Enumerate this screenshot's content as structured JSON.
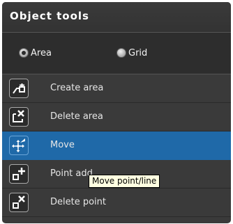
{
  "header": {
    "title": "Object tools"
  },
  "mode": {
    "options": [
      {
        "label": "Area",
        "checked": true
      },
      {
        "label": "Grid",
        "checked": false
      }
    ]
  },
  "tools": [
    {
      "label": "Create area",
      "icon": "create-area-icon",
      "selected": false
    },
    {
      "label": "Delete area",
      "icon": "delete-area-icon",
      "selected": false
    },
    {
      "label": "Move",
      "icon": "move-icon",
      "selected": true
    },
    {
      "label": "Point add",
      "icon": "point-add-icon",
      "selected": false
    },
    {
      "label": "Delete point",
      "icon": "delete-point-icon",
      "selected": false
    }
  ],
  "tooltip": {
    "text": "Move point/line"
  },
  "colors": {
    "panel": "#3a3a3a",
    "selected_row": "#1f69a8",
    "tooltip_bg": "#ffffe1"
  }
}
